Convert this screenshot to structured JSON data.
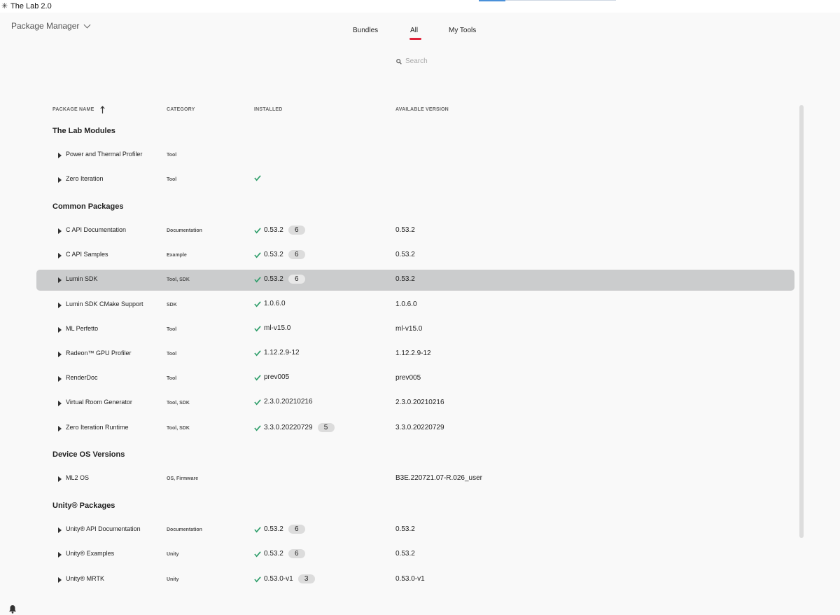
{
  "window": {
    "title": "The Lab 2.0",
    "icon": "snowflake-icon"
  },
  "header": {
    "dropdown_label": "Package Manager"
  },
  "tabs": [
    {
      "label": "Bundles",
      "active": false
    },
    {
      "label": "All",
      "active": true
    },
    {
      "label": "My Tools",
      "active": false
    }
  ],
  "search": {
    "placeholder": "Search",
    "icon": "search-icon"
  },
  "columns": {
    "name": "PACKAGE NAME",
    "category": "CATEGORY",
    "installed": "INSTALLED",
    "available": "AVAILABLE VERSION"
  },
  "groups": [
    {
      "title": "The Lab Modules",
      "rows": [
        {
          "name": "Power and Thermal Profiler",
          "category": "Tool",
          "installed": "",
          "installed_check": false,
          "badge": "",
          "available": ""
        },
        {
          "name": "Zero Iteration",
          "category": "Tool",
          "installed": "",
          "installed_check": true,
          "badge": "",
          "available": ""
        }
      ]
    },
    {
      "title": "Common Packages",
      "rows": [
        {
          "name": "C API Documentation",
          "category": "Documentation",
          "installed": "0.53.2",
          "installed_check": true,
          "badge": "6",
          "available": "0.53.2"
        },
        {
          "name": "C API Samples",
          "category": "Example",
          "installed": "0.53.2",
          "installed_check": true,
          "badge": "6",
          "available": "0.53.2"
        },
        {
          "name": "Lumin SDK",
          "category": "Tool, SDK",
          "installed": "0.53.2",
          "installed_check": true,
          "badge": "6",
          "available": "0.53.2",
          "selected": true
        },
        {
          "name": "Lumin SDK CMake Support",
          "category": "SDK",
          "installed": "1.0.6.0",
          "installed_check": true,
          "badge": "",
          "available": "1.0.6.0"
        },
        {
          "name": "ML Perfetto",
          "category": "Tool",
          "installed": "ml-v15.0",
          "installed_check": true,
          "badge": "",
          "available": "ml-v15.0"
        },
        {
          "name": "Radeon™ GPU Profiler",
          "category": "Tool",
          "installed": "1.12.2.9-12",
          "installed_check": true,
          "badge": "",
          "available": "1.12.2.9-12"
        },
        {
          "name": "RenderDoc",
          "category": "Tool",
          "installed": "prev005",
          "installed_check": true,
          "badge": "",
          "available": "prev005"
        },
        {
          "name": "Virtual Room Generator",
          "category": "Tool, SDK",
          "installed": "2.3.0.20210216",
          "installed_check": true,
          "badge": "",
          "available": "2.3.0.20210216"
        },
        {
          "name": "Zero Iteration Runtime",
          "category": "Tool, SDK",
          "installed": "3.3.0.20220729",
          "installed_check": true,
          "badge": "5",
          "available": "3.3.0.20220729"
        }
      ]
    },
    {
      "title": "Device OS Versions",
      "rows": [
        {
          "name": "ML2 OS",
          "category": "OS, Firmware",
          "installed": "",
          "installed_check": false,
          "badge": "",
          "available": "B3E.220721.07-R.026_user"
        }
      ]
    },
    {
      "title": "Unity® Packages",
      "rows": [
        {
          "name": "Unity® API Documentation",
          "category": "Documentation",
          "installed": "0.53.2",
          "installed_check": true,
          "badge": "6",
          "available": "0.53.2"
        },
        {
          "name": "Unity® Examples",
          "category": "Unity",
          "installed": "0.53.2",
          "installed_check": true,
          "badge": "6",
          "available": "0.53.2"
        },
        {
          "name": "Unity® MRTK",
          "category": "Unity",
          "installed": "0.53.0-v1",
          "installed_check": true,
          "badge": "3",
          "available": "0.53.0-v1"
        }
      ]
    }
  ],
  "colors": {
    "accent_tab": "#e0223a",
    "check": "#2e9e6a",
    "selected_row": "#cbcccd"
  },
  "footer": {
    "icon": "bell-icon"
  }
}
